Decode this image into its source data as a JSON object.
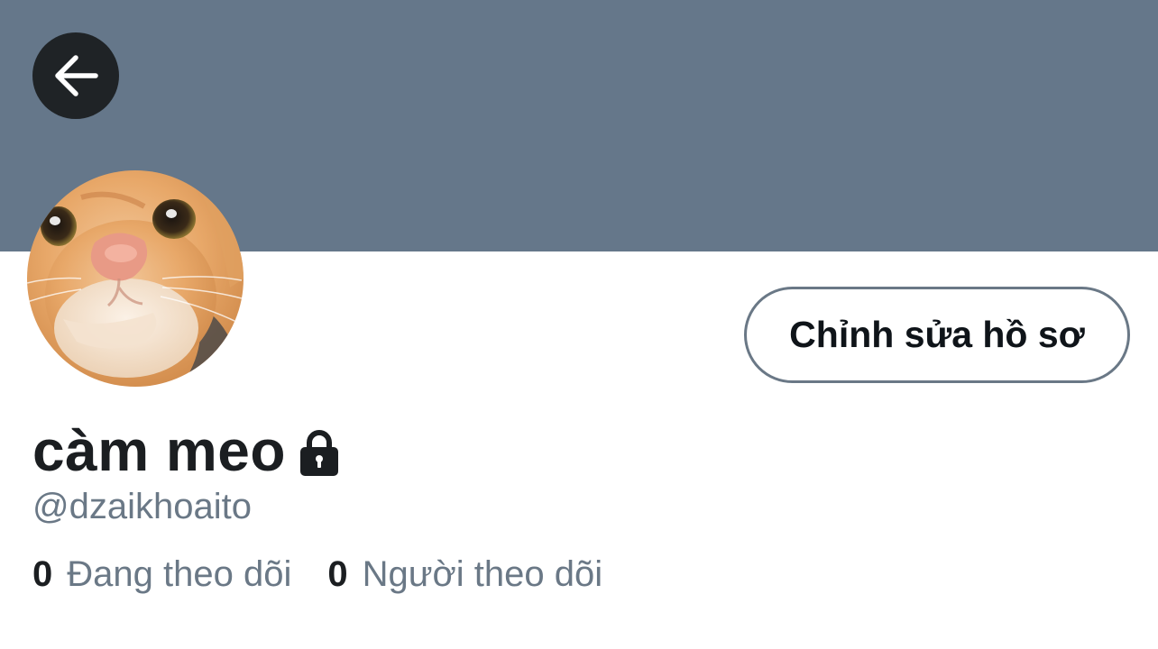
{
  "colors": {
    "banner": "#65778a",
    "back_button_bg": "#1f2326",
    "text_primary": "#1b1e21",
    "text_secondary": "#6a7886",
    "button_border": "#6a7886"
  },
  "header": {
    "back_icon": "arrow-left-icon"
  },
  "profile": {
    "avatar": "cat-avatar",
    "edit_button_label": "Chỉnh sửa hồ sơ",
    "display_name": "càm meo",
    "protected_icon": "lock-icon",
    "handle": "@dzaikhoaito"
  },
  "stats": [
    {
      "count": "0",
      "label": "Đang theo dõi"
    },
    {
      "count": "0",
      "label": "Người theo dõi"
    }
  ]
}
